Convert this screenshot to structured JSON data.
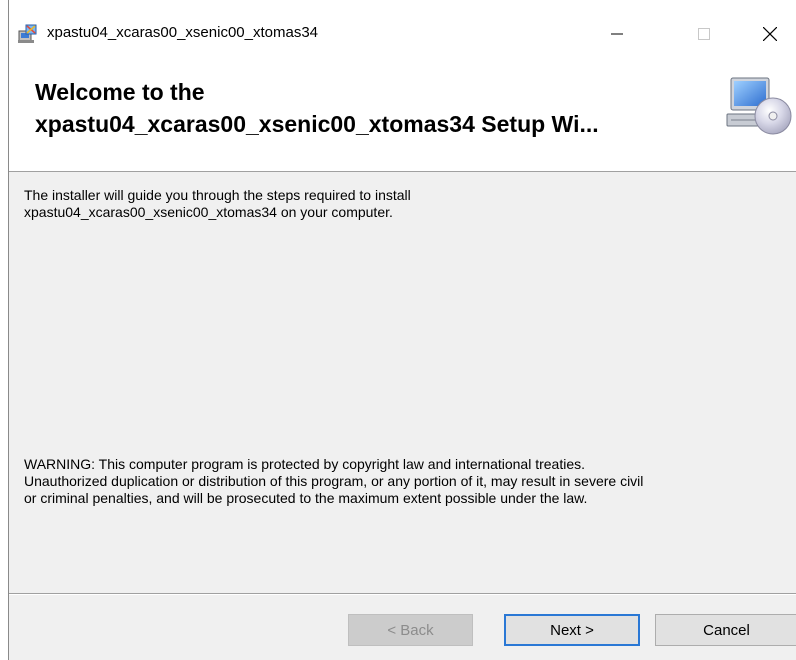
{
  "window": {
    "title": "xpastu04_xcaras00_xsenic00_xtomas34",
    "controls": {
      "minimize": "minimize",
      "maximize": "maximize",
      "close": "close"
    }
  },
  "banner": {
    "title_line1": "Welcome to the",
    "title_line2": "xpastu04_xcaras00_xsenic00_xtomas34 Setup Wi..."
  },
  "content": {
    "intro_line1": "The installer will guide you through the steps required to install",
    "intro_line2": "xpastu04_xcaras00_xsenic00_xtomas34 on your computer.",
    "warning_line1": "WARNING: This computer program is protected by copyright law and international treaties.",
    "warning_line2": "Unauthorized duplication or distribution of this program, or any portion of it, may result in severe civil",
    "warning_line3": "or criminal penalties, and will be prosecuted to the maximum extent possible under the law."
  },
  "buttons": {
    "back": "< Back",
    "next": "Next >",
    "cancel": "Cancel"
  },
  "colors": {
    "focus_border": "#2a78d5",
    "dialog_bg": "#f0f0f0",
    "banner_bg": "#ffffff"
  }
}
